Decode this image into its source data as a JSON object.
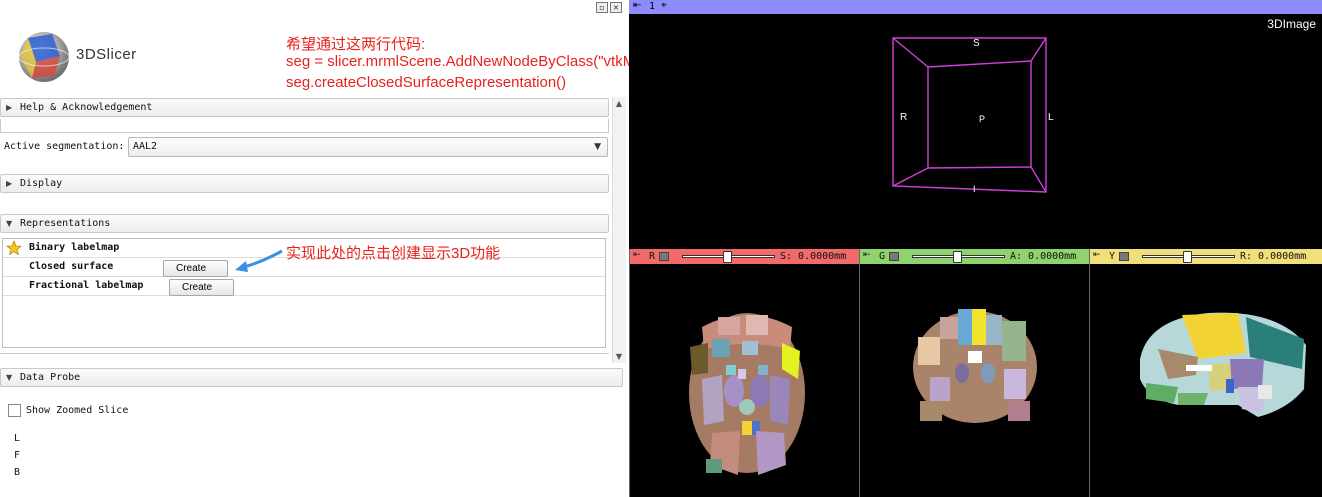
{
  "app": {
    "logo_text": "3DSlicer"
  },
  "annotations": {
    "title": "希望通过这两行代码:",
    "code_line1": "seg = slicer.mrmlScene.AddNewNodeByClass(\"vtkMrMLSegmentationNode\")",
    "code_line2": "seg.createClosedSurfaceRepresentation()",
    "arrow_note": "实现此处的点击创建显示3D功能",
    "color": "#e8231c"
  },
  "panel": {
    "help_section": "Help & Acknowledgement",
    "active_segmentation_label": "Active segmentation:",
    "active_segmentation_value": "AAL2",
    "display_section": "Display",
    "representations_section": "Representations",
    "representations": [
      {
        "name": "Binary labelmap",
        "master": true,
        "button": ""
      },
      {
        "name": "Closed surface",
        "master": false,
        "button": "Create"
      },
      {
        "name": "Fractional labelmap",
        "master": false,
        "button": "Create"
      }
    ],
    "data_probe_section": "Data Probe",
    "show_zoomed_slice": "Show Zoomed Slice",
    "probe_lines": [
      "L",
      "F",
      "B"
    ]
  },
  "viewer3d": {
    "layout_number": "1",
    "label": "3DImage",
    "orientation": {
      "top": "S",
      "left": "R",
      "right": "L",
      "center": "P",
      "bottom": "I"
    },
    "color": "#8c8cff"
  },
  "slice_views": [
    {
      "letter": "R",
      "offset": "S: 0.0000mm",
      "color": "#f26a6a"
    },
    {
      "letter": "G",
      "offset": "A: 0.0000mm",
      "color": "#8ed36e"
    },
    {
      "letter": "Y",
      "offset": "R: 0.0000mm",
      "color": "#f1e07a"
    }
  ]
}
